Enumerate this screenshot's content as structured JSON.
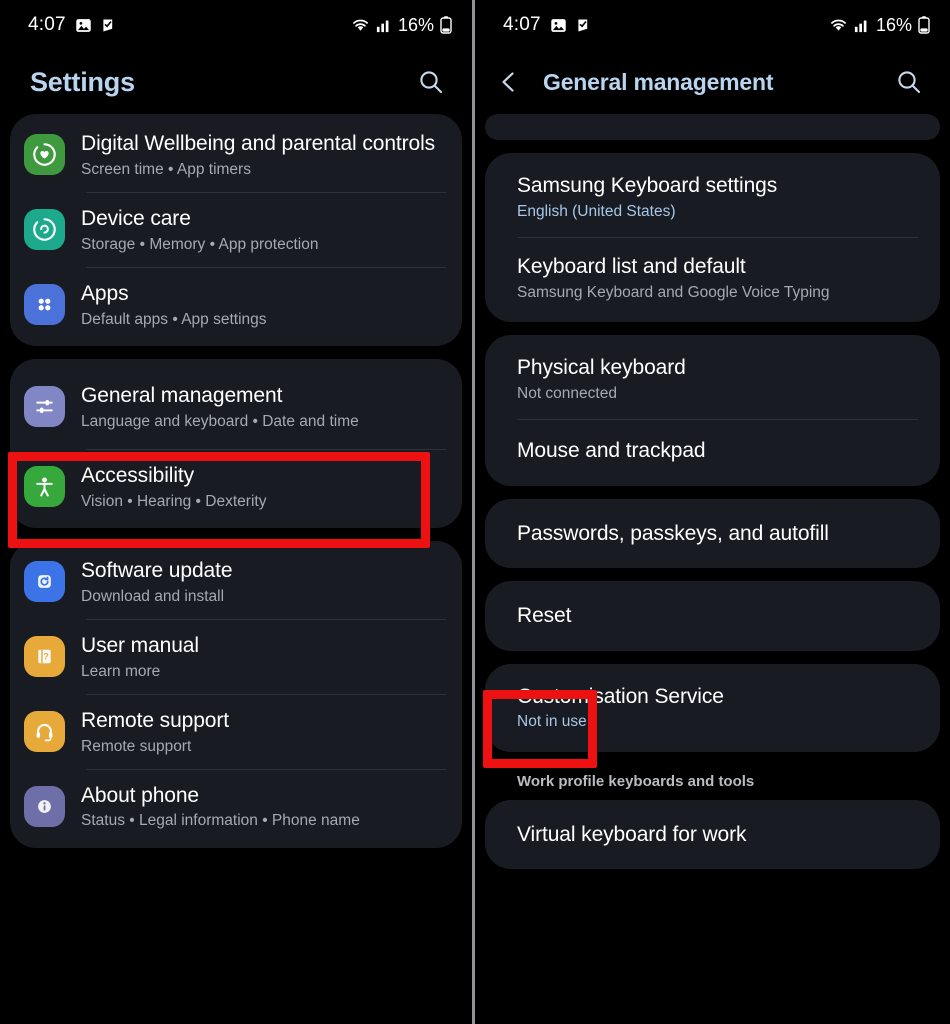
{
  "status_bar": {
    "time": "4:07",
    "battery_percent": "16%",
    "icons": [
      "gallery-icon",
      "app-badge-icon",
      "wifi-icon",
      "signal-icon",
      "battery-icon"
    ]
  },
  "colors": {
    "accent_text": "#a8c7e8",
    "card_bg": "#181c22",
    "screen_bg": "#000000",
    "highlight": "#ee1111",
    "title_text": "#ffffff",
    "subtitle_text": "#a6a9ae"
  },
  "left_screen": {
    "header": {
      "title": "Settings",
      "search_icon": "search-icon"
    },
    "groups": [
      {
        "items": [
          {
            "title": "Digital Wellbeing and parental controls",
            "subtitle": "Screen time  •  App timers",
            "icon": "digital-wellbeing-icon",
            "icon_color": "#3f9a3f"
          },
          {
            "title": "Device care",
            "subtitle": "Storage  •  Memory  •  App protection",
            "icon": "device-care-icon",
            "icon_color": "#1da98b"
          },
          {
            "title": "Apps",
            "subtitle": "Default apps  •  App settings",
            "icon": "apps-icon",
            "icon_color": "#4a72d8"
          }
        ]
      },
      {
        "items": [
          {
            "title": "General management",
            "subtitle": "Language and keyboard  •  Date and time",
            "icon": "sliders-icon",
            "icon_color": "#8186c4",
            "highlighted": true
          },
          {
            "title": "Accessibility",
            "subtitle": "Vision  •  Hearing  •  Dexterity",
            "icon": "accessibility-icon",
            "icon_color": "#37a83c"
          }
        ]
      },
      {
        "items": [
          {
            "title": "Software update",
            "subtitle": "Download and install",
            "icon": "software-update-icon",
            "icon_color": "#3c74e8"
          },
          {
            "title": "User manual",
            "subtitle": "Learn more",
            "icon": "user-manual-icon",
            "icon_color": "#e7a93a"
          },
          {
            "title": "Remote support",
            "subtitle": "Remote support",
            "icon": "headset-icon",
            "icon_color": "#e7a93a"
          },
          {
            "title": "About phone",
            "subtitle": "Status  •  Legal information  •  Phone name",
            "icon": "info-icon",
            "icon_color": "#6e6fa8"
          }
        ]
      }
    ]
  },
  "right_screen": {
    "header": {
      "title": "General management",
      "back_icon": "chevron-left-icon",
      "search_icon": "search-icon"
    },
    "groups": [
      {
        "items": [
          {
            "title": "Samsung Keyboard settings",
            "subtitle": "English (United States)",
            "subtitle_accent": true
          },
          {
            "title": "Keyboard list and default",
            "subtitle": "Samsung Keyboard and Google Voice Typing",
            "subtitle_accent": false
          }
        ]
      },
      {
        "items": [
          {
            "title": "Physical keyboard",
            "subtitle": "Not connected",
            "subtitle_accent": false
          },
          {
            "title": "Mouse and trackpad",
            "subtitle": "",
            "subtitle_accent": false
          }
        ]
      },
      {
        "items": [
          {
            "title": "Passwords, passkeys, and autofill",
            "subtitle": "",
            "subtitle_accent": false
          }
        ]
      },
      {
        "items": [
          {
            "title": "Reset",
            "subtitle": "",
            "subtitle_accent": false,
            "highlighted": true
          }
        ]
      },
      {
        "items": [
          {
            "title": "Customisation Service",
            "subtitle": "Not in use",
            "subtitle_accent": true
          }
        ]
      }
    ],
    "section_label": "Work profile keyboards and tools",
    "work_group": {
      "items": [
        {
          "title": "Virtual keyboard for work",
          "subtitle": "",
          "subtitle_accent": false
        }
      ]
    }
  }
}
